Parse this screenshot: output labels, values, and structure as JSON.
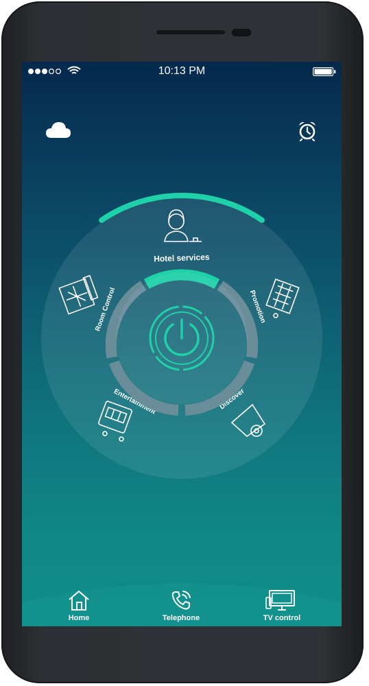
{
  "status_bar": {
    "time": "10:13 PM"
  },
  "header": {
    "left_icon": "cloud-icon",
    "right_icon": "alarm-clock-icon"
  },
  "menu": {
    "top": "Hotel services",
    "left": "Room Control",
    "right": "Promotion",
    "bottom_left": "Entertainment",
    "bottom_right": "Discover",
    "center_icon": "power-icon",
    "accent_color": "#1fd1a8"
  },
  "tabs": [
    {
      "label": "Home",
      "icon": "home-icon"
    },
    {
      "label": "Telephone",
      "icon": "telephone-icon"
    },
    {
      "label": "TV control",
      "icon": "tv-icon"
    }
  ]
}
